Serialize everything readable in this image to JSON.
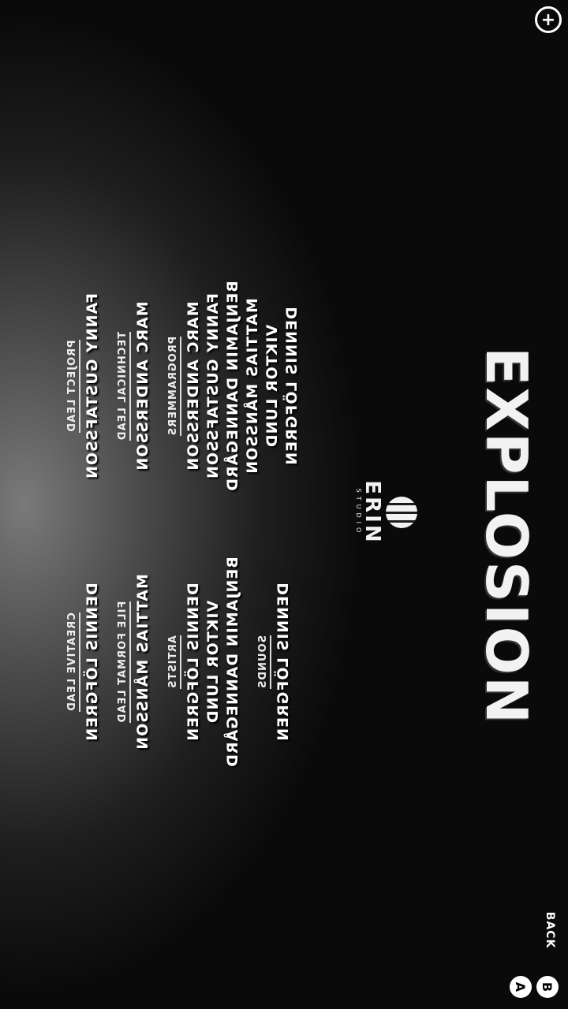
{
  "logo_text": "EXPLOSION",
  "studio": {
    "name": "ERIN",
    "sub": "STUDIO"
  },
  "columns_left": [
    {
      "heading": "PROJECT LEAD",
      "names": [
        "FANNY GUSTAFSSON"
      ]
    },
    {
      "heading": "TECHNICAL LEAD",
      "names": [
        "MARC ANDERSSON"
      ]
    },
    {
      "heading": "PROGRAMMERS",
      "names": [
        "MARC ANDERSSON",
        "FANNY GUSTAFSSON",
        "BENJAMIN DANNEGÅRD",
        "MATTIAS MÅNSSON",
        "VIKTOR LUND",
        "DENNIS LÖFGREN"
      ]
    }
  ],
  "columns_right": [
    {
      "heading": "CREATIVE LEAD",
      "names": [
        "DENNIS LÖFGREN"
      ]
    },
    {
      "heading": "FILE FORMAT LEAD",
      "names": [
        "MATTIAS MÅNSSON"
      ]
    },
    {
      "heading": "ARTISTS",
      "names": [
        "DENNIS LÖFGREN",
        "VIKTOR LUND",
        "BENJAMIN DANNEGÅRD"
      ]
    },
    {
      "heading": "SOUNDS",
      "names": [
        "DENNIS LÖFGREN"
      ]
    }
  ],
  "controls": {
    "plus_icon": "dpad-plus-icon",
    "back_label": "BACK",
    "b_button": "B",
    "a_button": "A"
  }
}
